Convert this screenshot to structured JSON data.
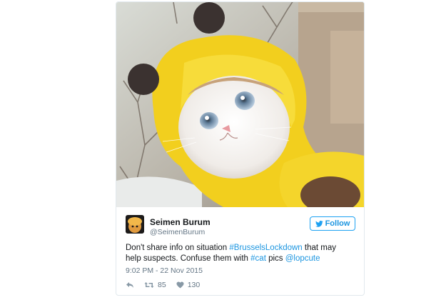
{
  "tweet": {
    "author_name": "Seimen Burum",
    "author_handle": "@SeimenBurum",
    "follow_label": "Follow",
    "text_parts": {
      "t1": "Don't share info on situation ",
      "link1": "#BrusselsLockdown",
      "t2": " that may help suspects. Confuse them with ",
      "link2": "#cat",
      "t3": " pics ",
      "link3": "@lopcute"
    },
    "timestamp": "9:02 PM - 22 Nov 2015",
    "retweets": "85",
    "likes": "130"
  },
  "icons": [
    "twitter-bird-icon",
    "reply-icon",
    "retweet-icon",
    "heart-icon"
  ],
  "colors": {
    "accent": "#1da1f2",
    "link": "#1b95e0",
    "text": "#14171a",
    "muted": "#657786",
    "hoodie_yellow": "#f2cf1e"
  }
}
